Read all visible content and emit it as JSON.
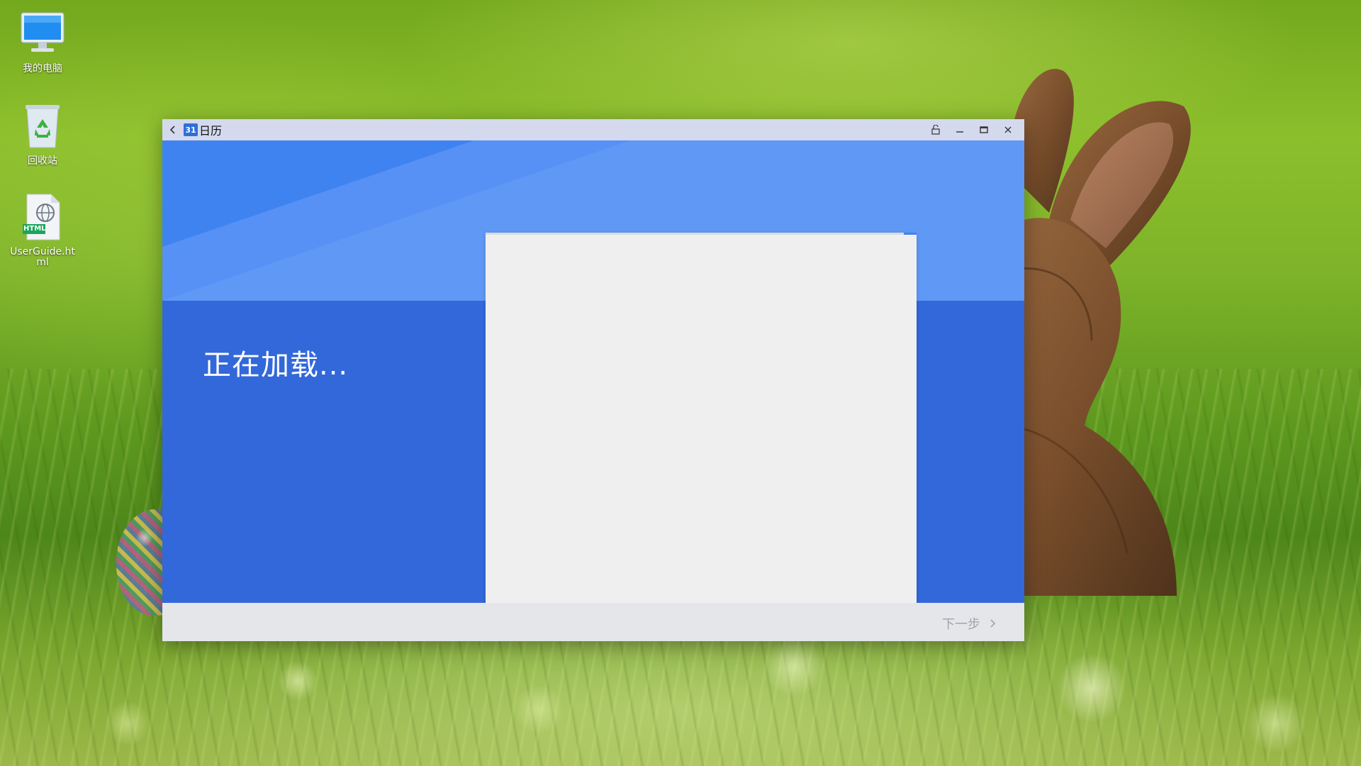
{
  "desktop": {
    "icons": [
      {
        "label": "我的电脑",
        "icon": "computer-icon"
      },
      {
        "label": "回收站",
        "icon": "recycle-bin-icon"
      },
      {
        "label": "UserGuide.html",
        "icon": "html-file-icon",
        "badge": "HTML"
      }
    ]
  },
  "window": {
    "title": "日历",
    "badge": "31",
    "controls": [
      "pin-icon",
      "minimize-icon",
      "maximize-icon",
      "close-icon"
    ],
    "loading_text": "正在加载...",
    "next_label": "下一步",
    "colors": {
      "titlebar": "#d4d9ee",
      "hero_light": "#6098f5",
      "hero_dark": "#3368da",
      "accent": "#3f83f0",
      "card": "#efeff0",
      "footer": "#e4e6ea"
    }
  }
}
